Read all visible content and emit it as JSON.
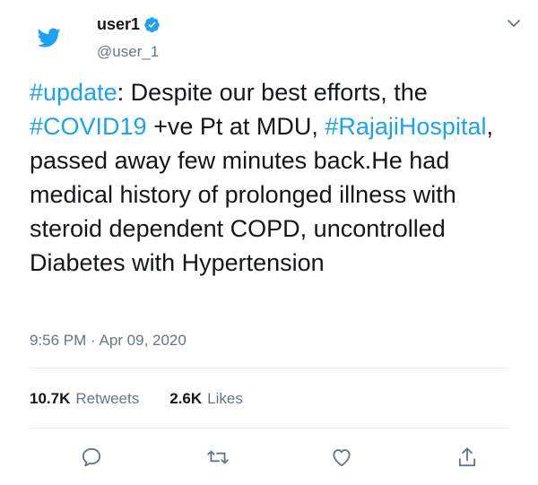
{
  "author": {
    "display_name": "user1",
    "handle": "@user_1",
    "verified": true
  },
  "tweet": {
    "segments": [
      {
        "text": "#update",
        "type": "hashtag"
      },
      {
        "text": ": Despite our best efforts, the ",
        "type": "text"
      },
      {
        "text": "#COVID19",
        "type": "hashtag"
      },
      {
        "text": " +ve Pt at MDU, ",
        "type": "text"
      },
      {
        "text": "#RajajiHospital",
        "type": "hashtag"
      },
      {
        "text": ", passed away few minutes back.He had medical history of prolonged illness with steroid dependent COPD, uncontrolled Diabetes with Hypertension",
        "type": "text"
      }
    ],
    "timestamp": "9:56 PM · Apr 09, 2020"
  },
  "stats": {
    "retweets_count": "10.7K",
    "retweets_label": "Retweets",
    "likes_count": "2.6K",
    "likes_label": "Likes"
  },
  "icons": {
    "logo": "twitter-bird-icon",
    "verified": "verified-badge-icon",
    "caret": "chevron-down-icon",
    "reply": "reply-icon",
    "retweet": "retweet-icon",
    "like": "heart-icon",
    "share": "share-icon"
  },
  "colors": {
    "brand": "#1da1f2",
    "text_primary": "#14171a",
    "text_secondary": "#657786",
    "divider": "#e6ecf0"
  }
}
